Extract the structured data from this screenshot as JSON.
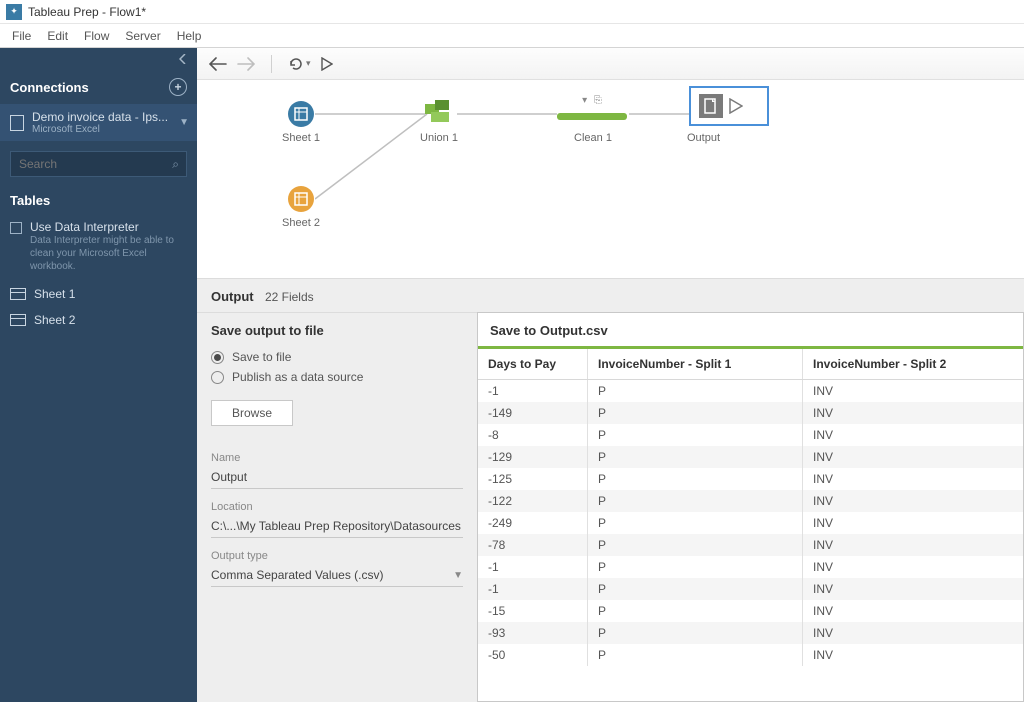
{
  "title": "Tableau Prep - Flow1*",
  "menu": {
    "file": "File",
    "edit": "Edit",
    "flow": "Flow",
    "server": "Server",
    "help": "Help"
  },
  "sidebar": {
    "connections_label": "Connections",
    "connection": {
      "name": "Demo invoice data - Ips...",
      "type": "Microsoft Excel"
    },
    "search_placeholder": "Search",
    "tables_label": "Tables",
    "interpreter": {
      "label": "Use Data Interpreter",
      "sub": "Data Interpreter might be able to clean your Microsoft Excel workbook."
    },
    "tables": [
      "Sheet 1",
      "Sheet 2"
    ]
  },
  "flow": {
    "nodes": {
      "sheet1": "Sheet 1",
      "sheet2": "Sheet 2",
      "union": "Union 1",
      "clean": "Clean 1",
      "output": "Output"
    }
  },
  "output": {
    "title": "Output",
    "field_count": "22 Fields",
    "save_heading": "Save output to file",
    "radio_save": "Save to file",
    "radio_publish": "Publish as a data source",
    "browse": "Browse",
    "name_label": "Name",
    "name_value": "Output",
    "location_label": "Location",
    "location_value": "C:\\...\\My Tableau Prep Repository\\Datasources",
    "type_label": "Output type",
    "type_value": "Comma Separated Values (.csv)",
    "preview_title": "Save to Output.csv",
    "columns": [
      "Days to Pay",
      "InvoiceNumber - Split 1",
      "InvoiceNumber - Split 2"
    ],
    "rows": [
      [
        "-1",
        "P",
        "INV"
      ],
      [
        "-149",
        "P",
        "INV"
      ],
      [
        "-8",
        "P",
        "INV"
      ],
      [
        "-129",
        "P",
        "INV"
      ],
      [
        "-125",
        "P",
        "INV"
      ],
      [
        "-122",
        "P",
        "INV"
      ],
      [
        "-249",
        "P",
        "INV"
      ],
      [
        "-78",
        "P",
        "INV"
      ],
      [
        "-1",
        "P",
        "INV"
      ],
      [
        "-1",
        "P",
        "INV"
      ],
      [
        "-15",
        "P",
        "INV"
      ],
      [
        "-93",
        "P",
        "INV"
      ],
      [
        "-50",
        "P",
        "INV"
      ]
    ]
  }
}
